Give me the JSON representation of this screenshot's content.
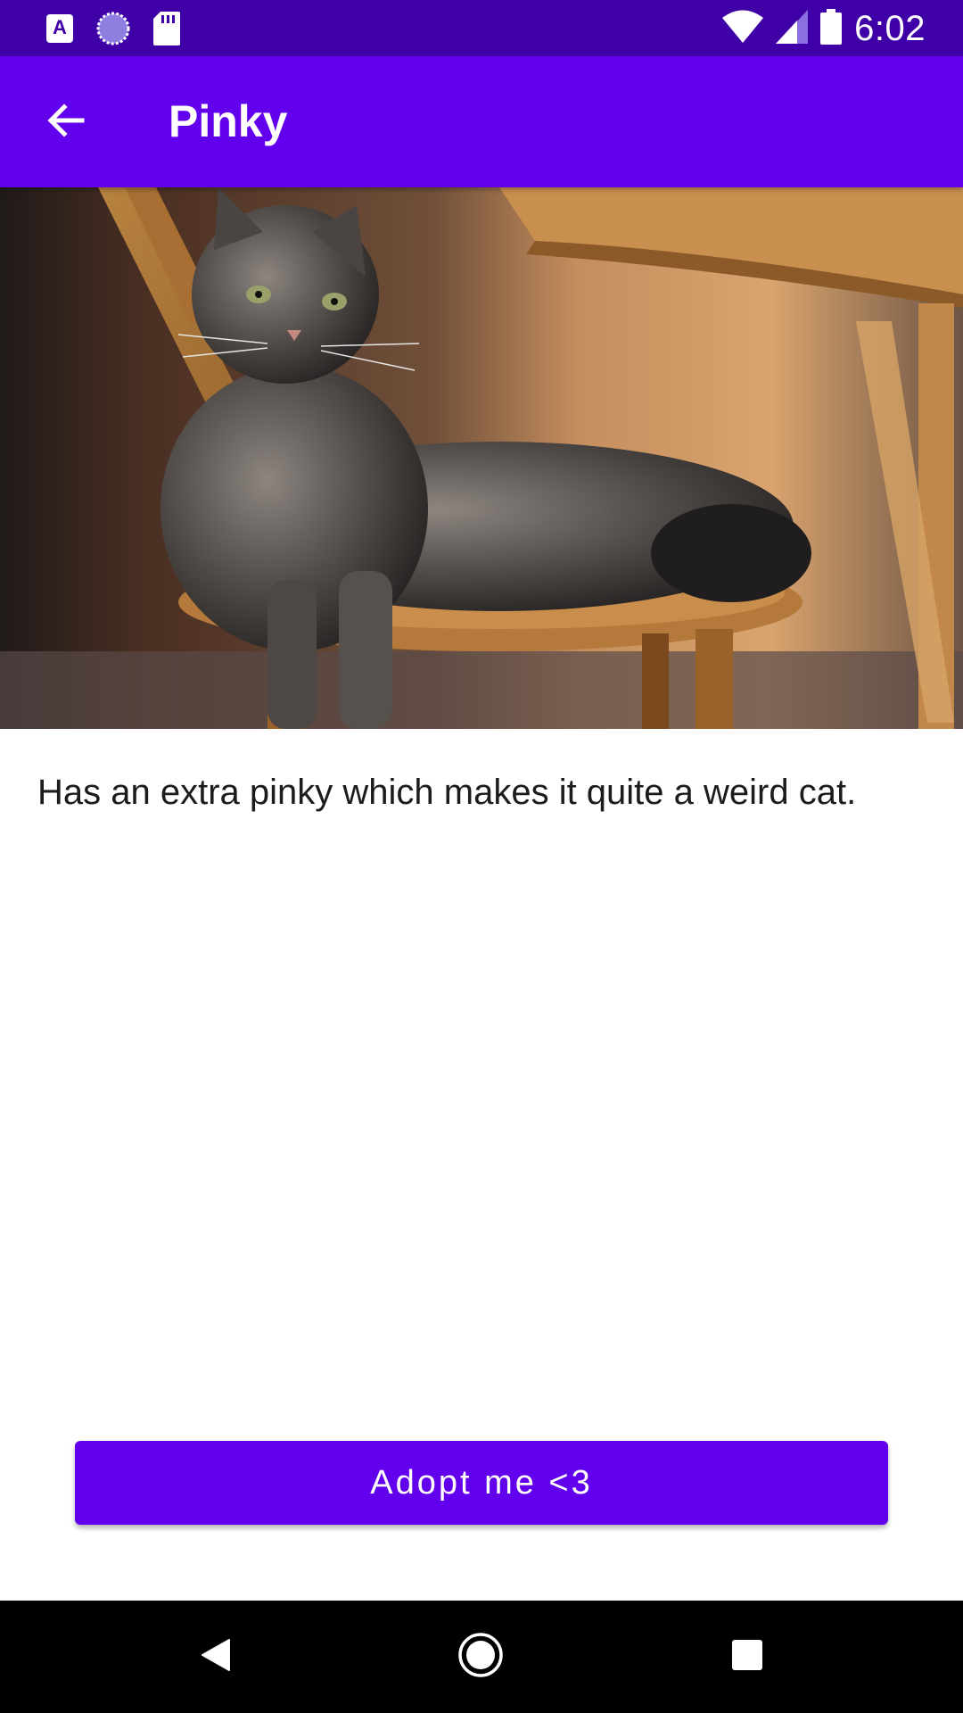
{
  "status_bar": {
    "time": "6:02",
    "left_icons": [
      "a-notification-icon",
      "sync-circle-icon",
      "sd-card-icon"
    ],
    "right_icons": [
      "wifi-icon",
      "cellular-signal-icon",
      "battery-icon"
    ]
  },
  "app_bar": {
    "title": "Pinky",
    "back_icon": "arrow-back-icon"
  },
  "pet": {
    "description": "Has an extra pinky which makes it quite a weird cat."
  },
  "actions": {
    "adopt_label": "Adopt me <3"
  },
  "nav_bar": {
    "buttons": [
      "back-triangle-icon",
      "home-circle-icon",
      "recents-square-icon"
    ]
  },
  "colors": {
    "primary": "#6200ee",
    "status_bar": "#3f00a8",
    "nav_bar": "#000000",
    "text": "#1c1c1c"
  }
}
